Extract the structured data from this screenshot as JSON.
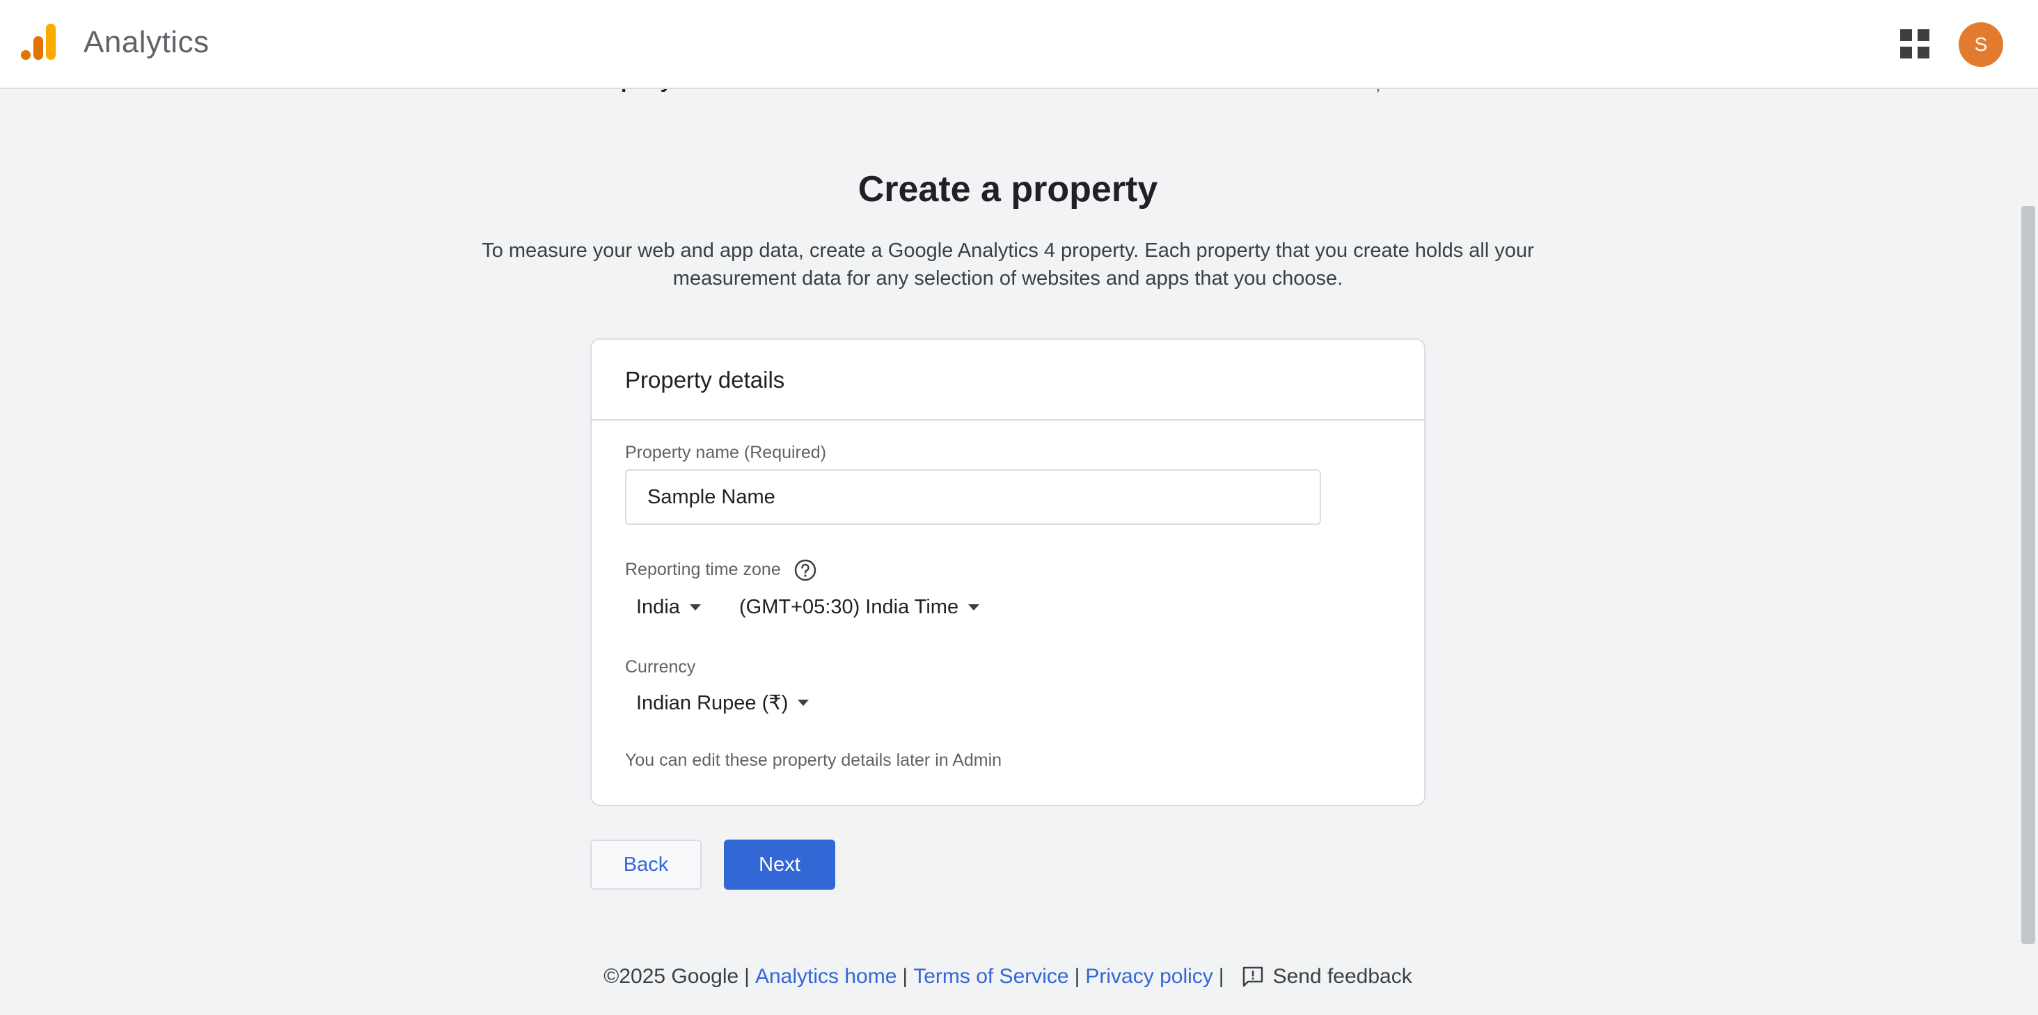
{
  "header": {
    "app_title": "Analytics",
    "avatar_initial": "S"
  },
  "stepper": {
    "current_step_label": "Property creation"
  },
  "main": {
    "title": "Create a property",
    "description": "To measure your web and app data, create a Google Analytics 4 property. Each property that you create holds all your measurement data for any selection of websites and apps that you choose."
  },
  "card": {
    "title": "Property details",
    "property_name_label": "Property name (Required)",
    "property_name_value": "Sample Name",
    "timezone_label": "Reporting time zone",
    "timezone_country": "India",
    "timezone_value": "(GMT+05:30) India Time",
    "currency_label": "Currency",
    "currency_value": "Indian Rupee (₹)",
    "hint": "You can edit these property details later in Admin"
  },
  "buttons": {
    "back": "Back",
    "next": "Next"
  },
  "footer": {
    "copyright": "©2025 Google",
    "analytics_home": "Analytics home",
    "terms": "Terms of Service",
    "privacy": "Privacy policy",
    "feedback": "Send feedback"
  },
  "colors": {
    "primary": "#3367d6",
    "avatar": "#e37b2e",
    "logo_dark": "#e37400",
    "logo_light": "#f9ab00",
    "background": "#f1f3f4"
  }
}
